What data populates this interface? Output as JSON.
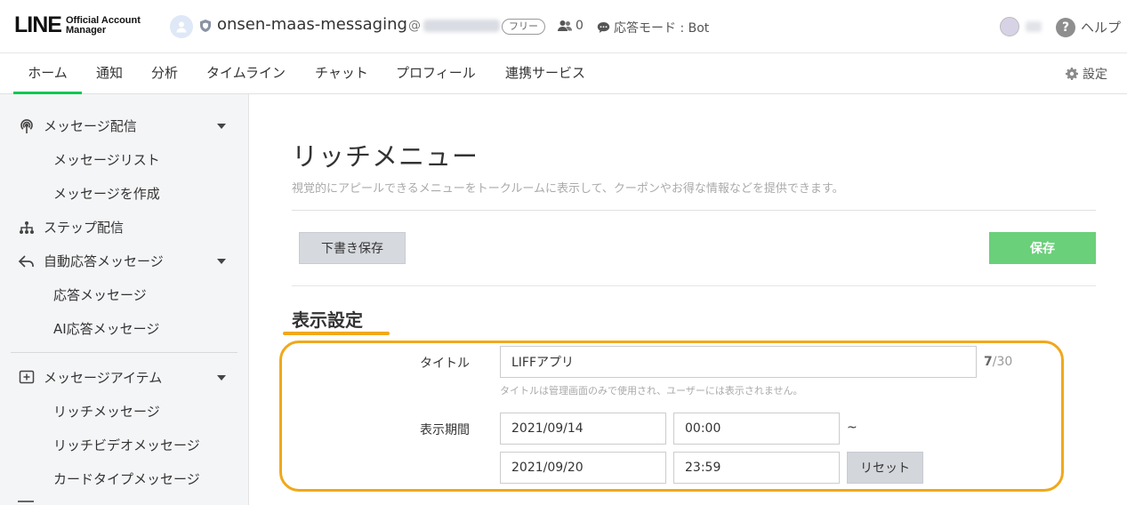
{
  "header": {
    "logo_main": "LINE",
    "logo_sub_1": "Official Account",
    "logo_sub_2": "Manager",
    "account_name": "onsen-maas-messaging",
    "account_id_prefix": "@",
    "plan_badge": "フリー",
    "friend_count": "0",
    "response_mode": "応答モード : Bot",
    "help_label": "ヘルプ"
  },
  "nav": {
    "tabs": [
      "ホーム",
      "通知",
      "分析",
      "タイムライン",
      "チャット",
      "プロフィール",
      "連携サービス"
    ],
    "active_tab": "ホーム",
    "settings_label": "設定",
    "accent_color": "#06c755"
  },
  "sidebar": {
    "groups": [
      {
        "label": "メッセージ配信",
        "icon": "broadcast-icon",
        "items": [
          "メッセージリスト",
          "メッセージを作成"
        ]
      },
      {
        "label": "ステップ配信",
        "icon": "step-tree-icon",
        "items": []
      },
      {
        "label": "自動応答メッセージ",
        "icon": "reply-arrow-icon",
        "items": [
          "応答メッセージ",
          "AI応答メッセージ"
        ]
      },
      {
        "label": "メッセージアイテム",
        "icon": "add-box-icon",
        "items": [
          "リッチメッセージ",
          "リッチビデオメッセージ",
          "カードタイプメッセージ"
        ]
      }
    ]
  },
  "main": {
    "title": "リッチメニュー",
    "description": "視覚的にアピールできるメニューをトークルームに表示して、クーポンやお得な情報などを提供できます。",
    "draft_button": "下書き保存",
    "save_button": "保存",
    "section_title": "表示設定",
    "highlight_color": "#f0a81b",
    "form": {
      "title_label": "タイトル",
      "title_value": "LIFFアプリ",
      "title_count": "7",
      "title_max": "/30",
      "title_hint": "タイトルは管理画面のみで使用され、ユーザーには表示されません。",
      "period_label": "表示期間",
      "start_date": "2021/09/14",
      "start_time": "00:00",
      "separator": "~",
      "end_date": "2021/09/20",
      "end_time": "23:59",
      "reset_button": "リセット"
    }
  }
}
